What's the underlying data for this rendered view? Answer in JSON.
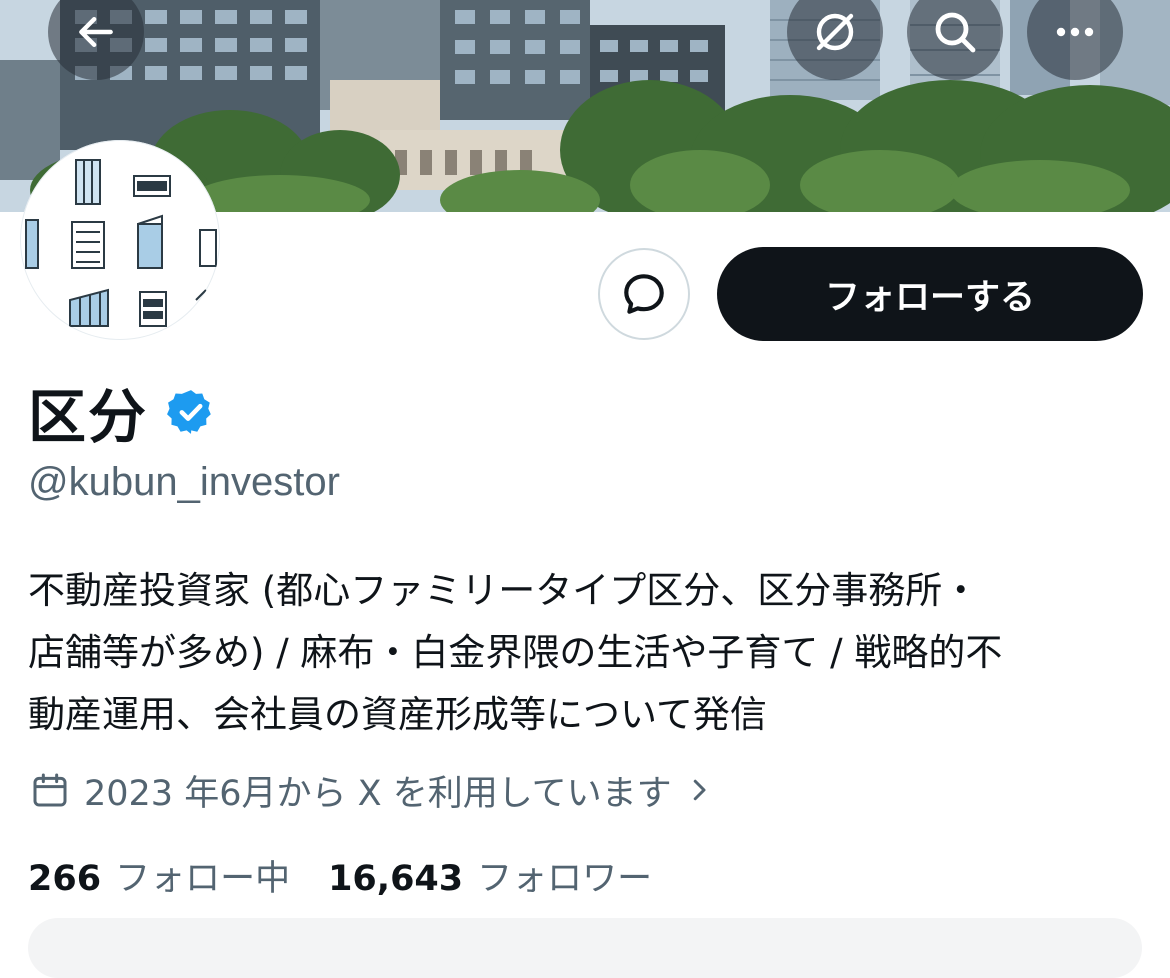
{
  "header": {
    "back_icon": "arrow-left-icon",
    "grok_icon": "no-symbol-icon",
    "search_icon": "search-icon",
    "more_icon": "more-horizontal-icon"
  },
  "profile": {
    "display_name": "区分",
    "verified": true,
    "handle": "@kubun_investor",
    "bio_lines": [
      "不動産投資家 (都心ファミリータイプ区分、区分事務所・",
      "店舗等が多め) / 麻布・白金界隈の生活や子育て / 戦略的不",
      "動産運用、会社員の資産形成等について発信"
    ],
    "joined": "2023 年6月から X を利用しています",
    "following_count": "266",
    "following_label": "フォロー中",
    "followers_count": "16,643",
    "followers_label": "フォロワー"
  },
  "actions": {
    "message_icon": "message-bubble-icon",
    "follow_label": "フォローする"
  },
  "colors": {
    "verified_badge": "#1d9bf0",
    "primary_text": "#0f1419",
    "secondary_text": "#536471",
    "follow_button_bg": "#0f1419"
  }
}
